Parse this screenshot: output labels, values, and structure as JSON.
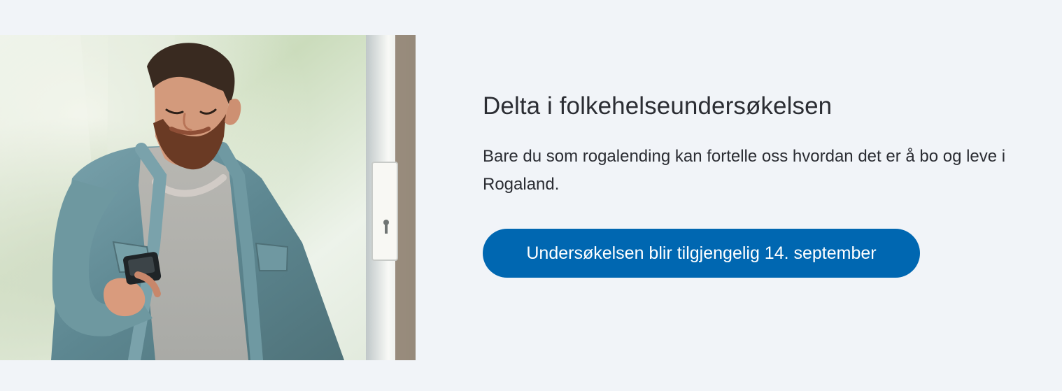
{
  "hero": {
    "image": {
      "subject": "man-looking-at-phone-photo",
      "icon": "photo-icon"
    },
    "title": "Delta i folkehelseundersøkelsen",
    "body_line_1": "Bare du som rogalending kan fortelle oss hvordan det er å bo og leve i",
    "body_line_2": "Rogaland.",
    "cta_label": "Undersøkelsen blir tilgjengelig 14. september"
  },
  "colors": {
    "page_background": "#f1f4f8",
    "text": "#2b2d33",
    "accent": "#0067b1",
    "button_text": "#ffffff"
  }
}
